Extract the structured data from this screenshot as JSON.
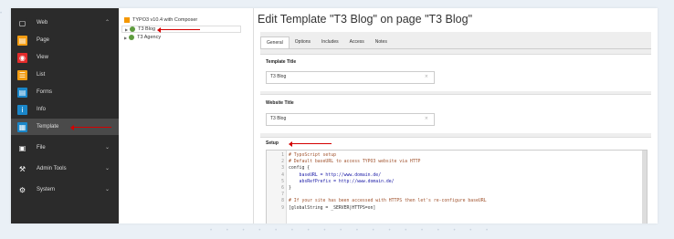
{
  "sidebar": {
    "items": [
      {
        "label": "Web",
        "icon": "web-icon",
        "color": "#2b2b2b",
        "glyph": "▢",
        "chevron": "^"
      },
      {
        "label": "Page",
        "icon": "page-icon",
        "color": "#f39c12",
        "glyph": "▤"
      },
      {
        "label": "View",
        "icon": "view-icon",
        "color": "#e32b2b",
        "glyph": "◉"
      },
      {
        "label": "List",
        "icon": "list-icon",
        "color": "#f39c12",
        "glyph": "☰"
      },
      {
        "label": "Forms",
        "icon": "forms-icon",
        "color": "#1a86c8",
        "glyph": "▤"
      },
      {
        "label": "Info",
        "icon": "info-icon",
        "color": "#1a86c8",
        "glyph": "i"
      },
      {
        "label": "Template",
        "icon": "template-icon",
        "color": "#1a86c8",
        "glyph": "▦"
      },
      {
        "label": "File",
        "icon": "file-icon",
        "color": "#2b2b2b",
        "glyph": "▣",
        "chevron": "v"
      },
      {
        "label": "Admin Tools",
        "icon": "admin-tools-icon",
        "color": "#2b2b2b",
        "glyph": "⚒",
        "chevron": "v"
      },
      {
        "label": "System",
        "icon": "system-icon",
        "color": "#2b2b2b",
        "glyph": "⚙",
        "chevron": "v"
      }
    ]
  },
  "tree": {
    "root": "TYPO3 v10.4 with Composer",
    "nodes": [
      "T3 Blog",
      "T3 Agency"
    ]
  },
  "main": {
    "title": "Edit Template \"T3 Blog\" on page \"T3 Blog\"",
    "tabs": [
      "General",
      "Options",
      "Includes",
      "Access",
      "Notes"
    ],
    "template_title_label": "Template Title",
    "template_title_value": "T3 Blog",
    "website_title_label": "Website Title",
    "website_title_value": "T3 Blog",
    "setup_label": "Setup",
    "clear_glyph": "×"
  },
  "code": [
    {
      "n": "1",
      "t": "# TypoScript setup",
      "k": "comment"
    },
    {
      "n": "2",
      "t": "# Default baseURL to access TYPO3 website via HTTP",
      "k": "comment"
    },
    {
      "n": "3",
      "t": "config {",
      "k": "plain"
    },
    {
      "n": "4",
      "t": "    baseURL = http://www.domain.de/",
      "k": "key"
    },
    {
      "n": "5",
      "t": "    absRefPrefix = http://www.domain.de/",
      "k": "key"
    },
    {
      "n": "6",
      "t": "}",
      "k": "plain"
    },
    {
      "n": "7",
      "t": "",
      "k": "plain"
    },
    {
      "n": "8",
      "t": "# If your site has been accessed with HTTPS then let's re-configure baseURL",
      "k": "comment"
    },
    {
      "n": "9",
      "t": "[globalString = _SERVER|HTTPS=on]",
      "k": "plain"
    }
  ],
  "colors": {
    "accent": "#d40000",
    "sidebar_bg": "#2b2b2b"
  }
}
